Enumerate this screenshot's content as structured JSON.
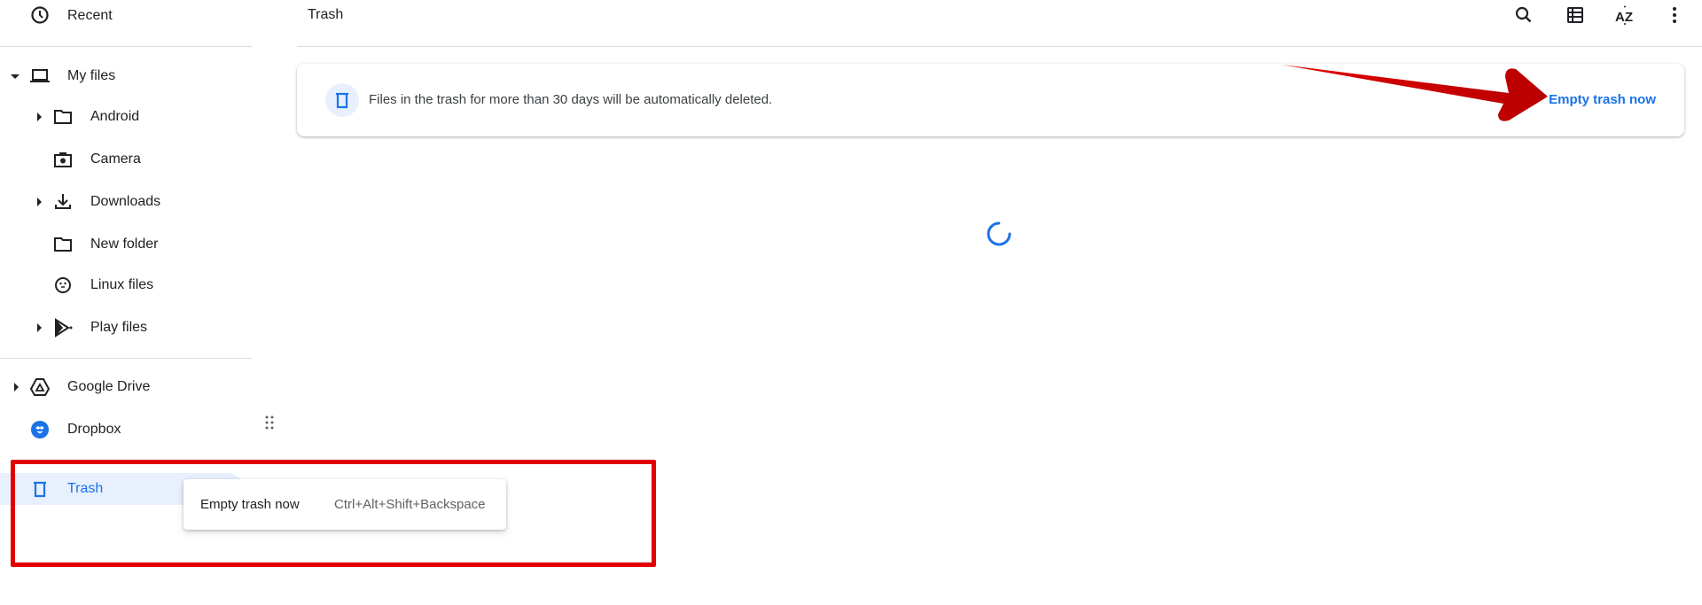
{
  "sidebar": {
    "items": [
      {
        "label": "Recent",
        "icon": "clock-icon"
      },
      {
        "label": "My files",
        "icon": "laptop-icon",
        "expanded": true
      },
      {
        "label": "Android",
        "icon": "folder-icon"
      },
      {
        "label": "Camera",
        "icon": "camera-icon"
      },
      {
        "label": "Downloads",
        "icon": "download-icon"
      },
      {
        "label": "New folder",
        "icon": "folder-icon"
      },
      {
        "label": "Linux files",
        "icon": "penguin-icon"
      },
      {
        "label": "Play files",
        "icon": "play-icon"
      },
      {
        "label": "Google Drive",
        "icon": "drive-icon"
      },
      {
        "label": "Dropbox",
        "icon": "dropbox-icon"
      },
      {
        "label": "Trash",
        "icon": "trash-icon",
        "selected": true
      }
    ]
  },
  "header": {
    "title": "Trash",
    "actions": [
      "search-icon",
      "list-view-icon",
      "sort-az-icon",
      "more-vert-icon"
    ]
  },
  "banner": {
    "message": "Files in the trash for more than 30 days will be automatically deleted.",
    "action_label": "Empty trash now"
  },
  "context_menu": {
    "item_label": "Empty trash now",
    "shortcut": "Ctrl+Alt+Shift+Backspace"
  },
  "colors": {
    "accent": "#1a73e8",
    "selected_bg": "#e8f0fe",
    "annotation_red": "#e00000"
  }
}
